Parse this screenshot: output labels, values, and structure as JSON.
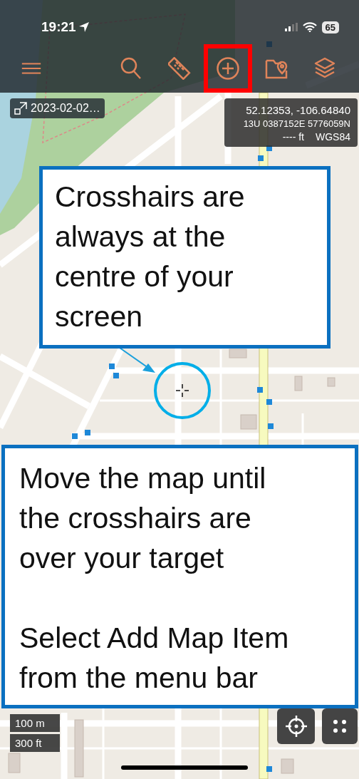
{
  "status_bar": {
    "time": "19:21",
    "battery": "65"
  },
  "toolbar": {
    "buttons": [
      {
        "kind": "menu",
        "highlighted": false
      },
      {
        "kind": "search",
        "highlighted": false
      },
      {
        "kind": "ruler",
        "highlighted": false
      },
      {
        "kind": "add",
        "highlighted": true
      },
      {
        "kind": "folder-pin",
        "highlighted": false
      },
      {
        "kind": "layers",
        "highlighted": false
      }
    ]
  },
  "track_chip": {
    "label": "2023-02-02…"
  },
  "coordinates": {
    "latlon": "52.12353, -106.64840",
    "utm": "13U 0387152E 5776059N",
    "elevation": "---- ft",
    "datum": "WGS84"
  },
  "callouts": [
    {
      "paragraphs": [
        "Crosshairs are always at the centre of your screen"
      ]
    },
    {
      "paragraphs": [
        "Move the map until the crosshairs are over your target",
        "Select Add Map Item from the menu bar"
      ]
    }
  ],
  "scale": {
    "metric": "100 m",
    "imperial": "300 ft"
  },
  "map_buttons": [
    {
      "kind": "locate"
    },
    {
      "kind": "grid"
    }
  ]
}
